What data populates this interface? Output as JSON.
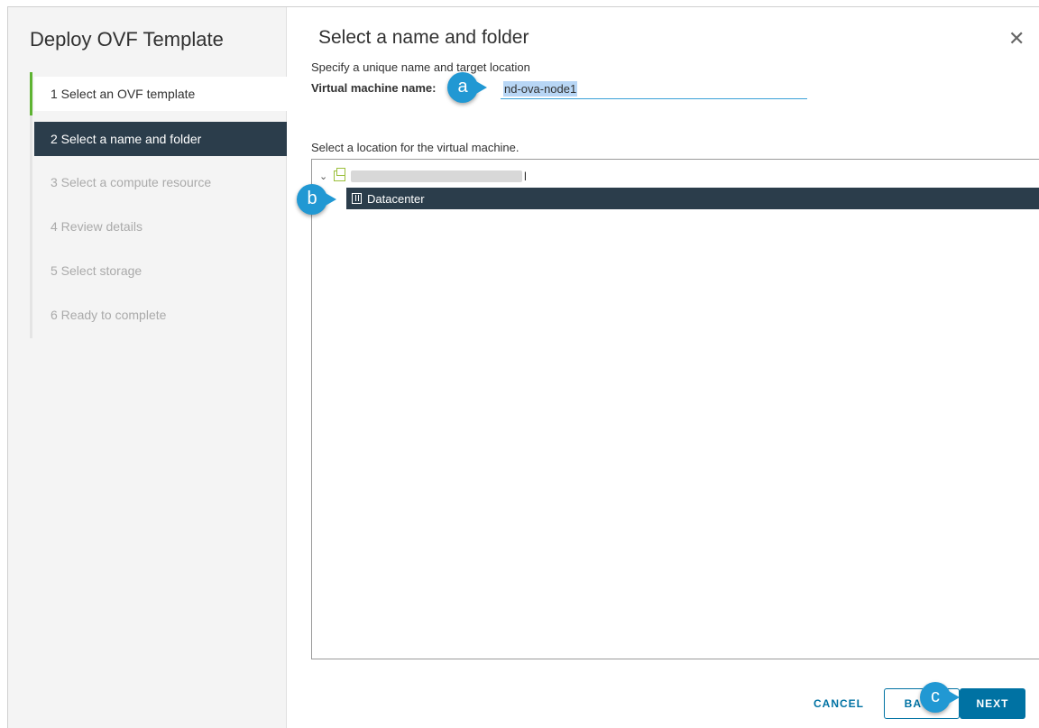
{
  "dialog": {
    "title": "Deploy OVF Template",
    "close_icon": "close-icon"
  },
  "steps": [
    {
      "label": "1  Select an OVF template",
      "state": "done"
    },
    {
      "label": "2  Select a name and folder",
      "state": "active"
    },
    {
      "label": "3  Select a compute resource",
      "state": "pending"
    },
    {
      "label": "4  Review details",
      "state": "pending"
    },
    {
      "label": "5  Select storage",
      "state": "pending"
    },
    {
      "label": "6  Ready to complete",
      "state": "pending"
    }
  ],
  "page": {
    "title": "Select a name and folder",
    "subtitle": "Specify a unique name and target location",
    "vm_name_label": "Virtual machine name:",
    "vm_name_value": "nd-ova-node1",
    "location_label": "Select a location for the virtual machine."
  },
  "tree": {
    "root_label": "",
    "root_icon": "vcenter-icon",
    "selected_item": {
      "label": "Datacenter",
      "icon": "datacenter-icon"
    }
  },
  "callouts": {
    "a": "a",
    "b": "b",
    "c": "c"
  },
  "footer": {
    "cancel_label": "CANCEL",
    "back_label": "BACK",
    "next_label": "NEXT"
  },
  "colors": {
    "accent": "#0072a3",
    "active_step_bg": "#2b3d4b",
    "done_marker": "#5eb332",
    "callout": "#2198d3"
  }
}
